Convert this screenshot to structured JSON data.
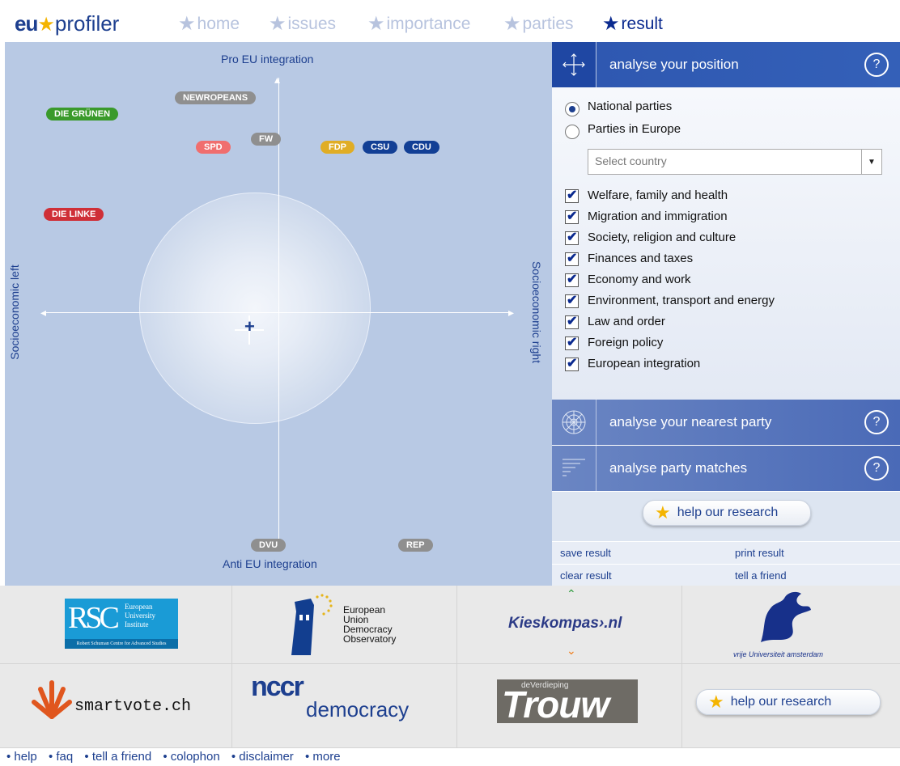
{
  "logo": {
    "eu": "eu",
    "profiler": "profiler"
  },
  "nav": [
    {
      "label": "home"
    },
    {
      "label": "issues"
    },
    {
      "label": "importance"
    },
    {
      "label": "parties"
    },
    {
      "label": "result"
    }
  ],
  "plot": {
    "top_label": "Pro EU integration",
    "bottom_label": "Anti EU integration",
    "left_label": "Socioeconomic left",
    "right_label": "Socioeconomic right",
    "parties": [
      {
        "name": "NEWROPEANS",
        "color": "#8f8f8f"
      },
      {
        "name": "DIE GRÜNEN",
        "color": "#3a9a2b"
      },
      {
        "name": "FW",
        "color": "#8f8f8f"
      },
      {
        "name": "SPD",
        "color": "#f06e6e"
      },
      {
        "name": "FDP",
        "color": "#e0ad25"
      },
      {
        "name": "CSU",
        "color": "#123f95"
      },
      {
        "name": "CDU",
        "color": "#123f95"
      },
      {
        "name": "DIE LINKE",
        "color": "#cf2f37"
      },
      {
        "name": "DVU",
        "color": "#8f8f8f"
      },
      {
        "name": "REP",
        "color": "#8f8f8f"
      }
    ]
  },
  "panel": {
    "analyse_position": "analyse your position",
    "option_national": "National parties",
    "option_europe": "Parties in Europe",
    "select_country": "Select country",
    "issues": [
      "Welfare, family and health",
      "Migration and immigration",
      "Society, religion and culture",
      "Finances and taxes",
      "Economy and work",
      "Environment, transport and energy",
      "Law and order",
      "Foreign policy",
      "European integration"
    ],
    "analyse_nearest": "analyse your nearest party",
    "analyse_matches": "analyse party matches",
    "help_research": "help our research",
    "save_result": "save result",
    "print_result": "print result",
    "clear_result": "clear result",
    "tell_friend": "tell a friend",
    "help_icon": "?"
  },
  "logos": {
    "rsc_abbr": "RSC",
    "rsc_lines": [
      "European",
      "University",
      "Institute"
    ],
    "rsc_sub": "Robert Schuman Centre for Advanced Studies",
    "eudo": [
      "European",
      "Union",
      "Democracy",
      "Observatory"
    ],
    "kieskompas": "Kieskompas›.nl",
    "vu": "vrije Universiteit  amsterdam",
    "smartvote": "smartvote.ch",
    "nccr": "nccr",
    "nccr_sub": "democracy",
    "trouw_small": "deVerdieping",
    "trouw": "Trouw",
    "help_research": "help our research"
  },
  "footer_links": [
    "• help",
    "• faq",
    "• tell a friend",
    "• colophon",
    "• disclaimer",
    "• more"
  ]
}
